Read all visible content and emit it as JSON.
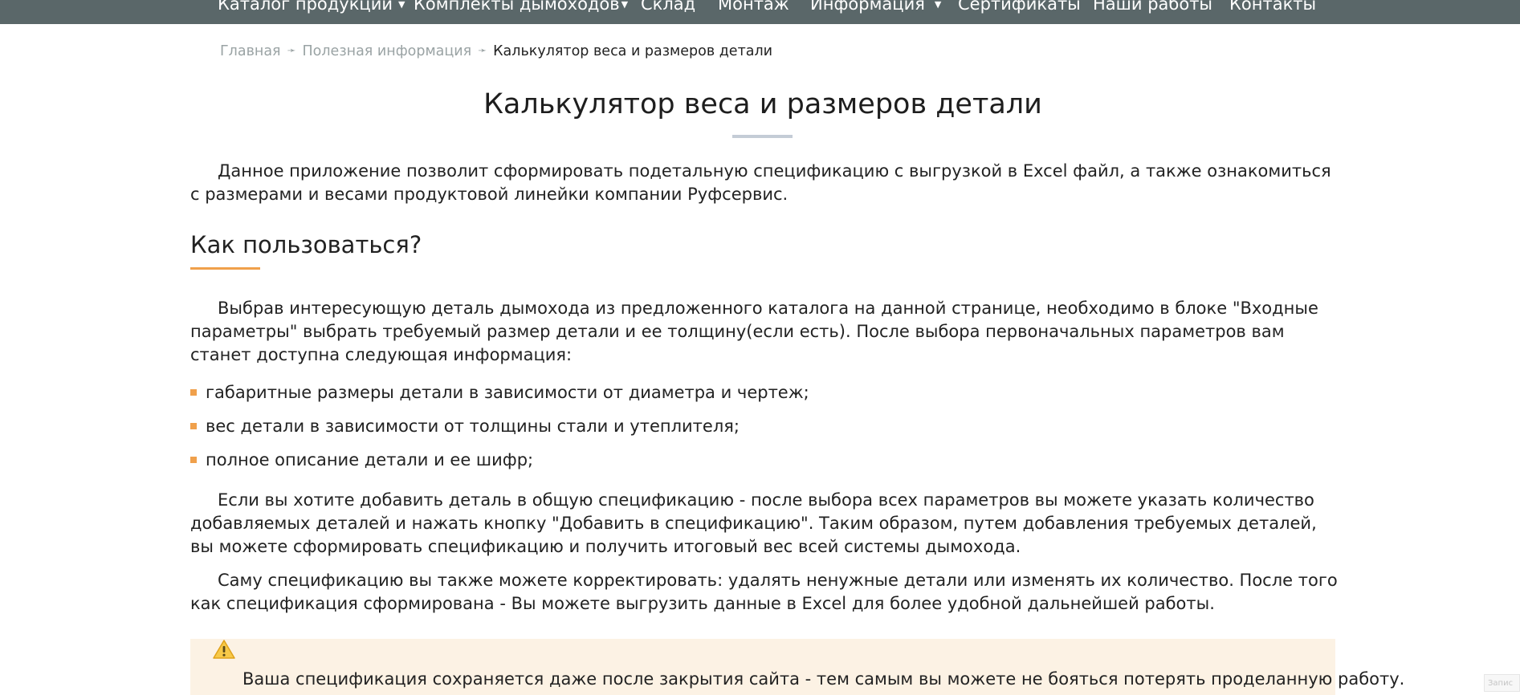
{
  "nav": {
    "items": [
      {
        "label": "Каталог продукции",
        "caret": "▼"
      },
      {
        "label": "Комплекты дымоходов",
        "caret": "▼"
      },
      {
        "label": "Склад"
      },
      {
        "label": "Монтаж"
      },
      {
        "label": "Информация",
        "caret": "▼"
      },
      {
        "label": "Сертификаты"
      },
      {
        "label": "Наши работы"
      },
      {
        "label": "Контакты"
      }
    ]
  },
  "breadcrumb": {
    "items": [
      "Главная",
      "Полезная информация"
    ],
    "separator": "➛",
    "current": "Калькулятор веса и размеров детали"
  },
  "page": {
    "title": "Калькулятор веса и размеров детали",
    "intro": "Данное приложение позволит сформировать подетальную спецификацию с выгрузкой в Excel файл, а также ознакомиться с размерами и весами продуктовой линейки компании Руфсервис.",
    "how_to_title": "Как пользоваться?",
    "how_to_p1": "Выбрав интересующую деталь дымохода из предложенного каталога на данной странице, необходимо в блоке \"Входные параметры\" выбрать требуемый размер детали и ее толщину(если есть). После выбора первоначальных параметров вам станет доступна следующая информация:",
    "bullets": [
      "габаритные размеры детали в зависимости от диаметра и чертеж;",
      "вес детали в зависимости от толщины стали и утеплителя;",
      "полное описание детали и ее шифр;"
    ],
    "how_to_p2": "Если вы хотите добавить деталь в общую спецификацию - после выбора всех параметров вы можете указать количество добавляемых деталей и нажать кнопку \"Добавить в спецификацию\". Таким образом, путем добавления требуемых деталей, вы можете сформировать спецификацию и получить итоговый вес всей системы дымохода.",
    "how_to_p3": "Саму спецификацию вы также можете корректировать: удалять ненужные детали или изменять их количество. После того как спецификация сформирована - Вы можете выгрузить данные в Excel для более удобной дальнейшей работы.",
    "notice": "Ваша спецификация сохраняется даже после закрытия сайта - тем самым вы можете не бояться потерять проделанную работу.",
    "notice_icon": "warning-icon",
    "corner_badge": "Запис"
  },
  "colors": {
    "nav_bg": "#5a6769",
    "accent": "#f0a04b",
    "notice_bg": "#fcf2e4",
    "crumb_link": "#9aa3a4"
  }
}
